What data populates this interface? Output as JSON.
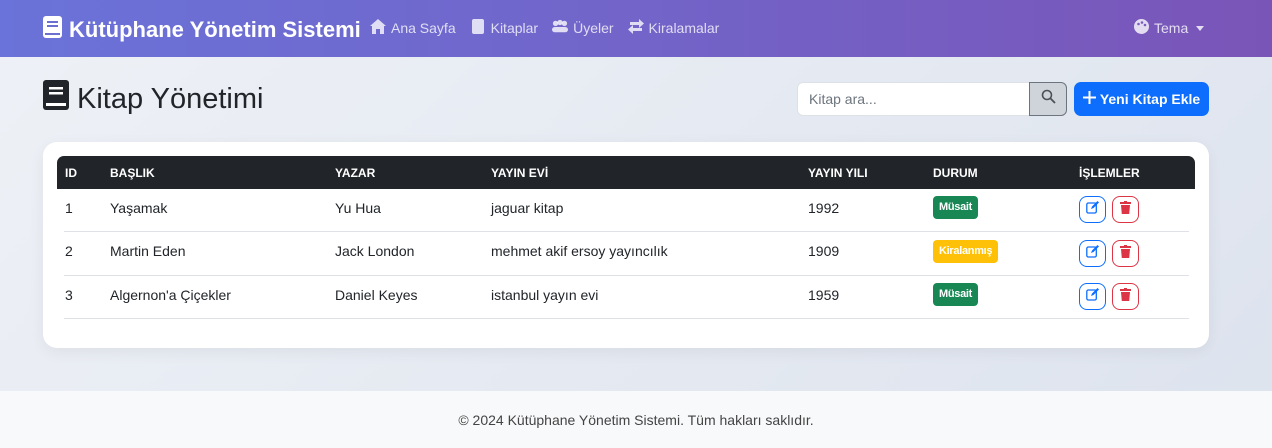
{
  "navbar": {
    "brand": "Kütüphane Yönetim Sistemi",
    "links": [
      {
        "label": "Ana Sayfa",
        "icon": "home-icon"
      },
      {
        "label": "Kitaplar",
        "icon": "book-icon"
      },
      {
        "label": "Üyeler",
        "icon": "users-icon"
      },
      {
        "label": "Kiralamalar",
        "icon": "exchange-icon"
      }
    ],
    "theme_label": "Tema"
  },
  "header": {
    "title": "Kitap Yönetimi",
    "search_placeholder": "Kitap ara...",
    "add_button": "Yeni Kitap Ekle"
  },
  "table": {
    "columns": [
      "ID",
      "BAŞLIK",
      "YAZAR",
      "YAYIN EVİ",
      "YAYIN YILI",
      "DURUM",
      "İŞLEMLER"
    ],
    "rows": [
      {
        "id": "1",
        "title": "Yaşamak",
        "author": "Yu Hua",
        "publisher": "jaguar kitap",
        "year": "1992",
        "status": "Müsait",
        "status_type": "available"
      },
      {
        "id": "2",
        "title": "Martin Eden",
        "author": "Jack London",
        "publisher": "mehmet akif ersoy yayıncılık",
        "year": "1909",
        "status": "Kiralanmış",
        "status_type": "rented"
      },
      {
        "id": "3",
        "title": "Algernon'a Çiçekler",
        "author": "Daniel Keyes",
        "publisher": "istanbul yayın evi",
        "year": "1959",
        "status": "Müsait",
        "status_type": "available"
      }
    ]
  },
  "footer": {
    "text": "© 2024 Kütüphane Yönetim Sistemi. Tüm hakları saklıdır."
  },
  "colors": {
    "primary": "#0d6efd",
    "success": "#198754",
    "warning": "#ffc107",
    "danger": "#dc3545",
    "table_header": "#212529"
  }
}
